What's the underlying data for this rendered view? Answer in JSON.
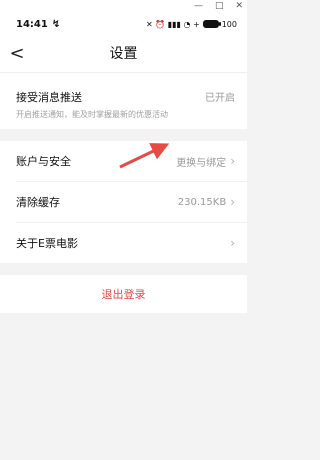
{
  "window": {
    "controls": [
      "—",
      "□",
      "✕"
    ]
  },
  "status": {
    "time": "14:41",
    "indicator": "↯",
    "icons": "✕ ⏰ ▮▮▮ ◔ +",
    "battery": "100"
  },
  "nav": {
    "title": "设置",
    "back_icon": "<"
  },
  "push": {
    "label": "接受消息推送",
    "subtitle": "开启推送通知，能及时掌握最新的优惠活动",
    "value": "已开启"
  },
  "account": {
    "label": "账户与安全",
    "value": "更换与绑定"
  },
  "cache": {
    "label": "清除缓存",
    "value": "230.15KB"
  },
  "about": {
    "label": "关于E票电影",
    "value": ""
  },
  "logout": {
    "label": "退出登录"
  },
  "colors": {
    "accent": "#e64b43",
    "background": "#f3f3f3"
  }
}
